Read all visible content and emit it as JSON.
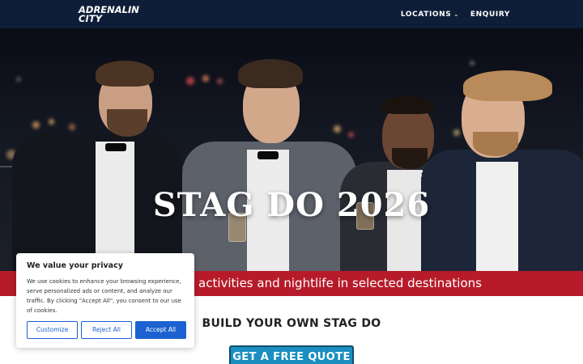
{
  "header": {
    "logo_line1": "ADRENALIN",
    "logo_line2": "CITY",
    "nav": [
      {
        "label": "LOCATIONS",
        "has_dropdown": true,
        "icon": "chevron-down-icon"
      },
      {
        "label": "ENQUIRY",
        "has_dropdown": false
      }
    ],
    "background": "#0f1e38"
  },
  "hero": {
    "title": "STAG DO 2026",
    "band_text": "activities and nightlife in selected destinations",
    "band_color": "#b71b2a"
  },
  "main": {
    "heading": "BUILD YOUR OWN STAG DO",
    "cta_label": "GET A FREE QUOTE",
    "cta_color": "#1a8fc0"
  },
  "cookie_banner": {
    "title": "We value your privacy",
    "text": "We use cookies to enhance your browsing experience, serve personalized ads or content, and analyze our traffic. By clicking \"Accept All\", you consent to our use of cookies.",
    "buttons": {
      "customize": "Customize",
      "reject": "Reject All",
      "accept": "Accept All"
    },
    "accent": "#1b62d0"
  }
}
